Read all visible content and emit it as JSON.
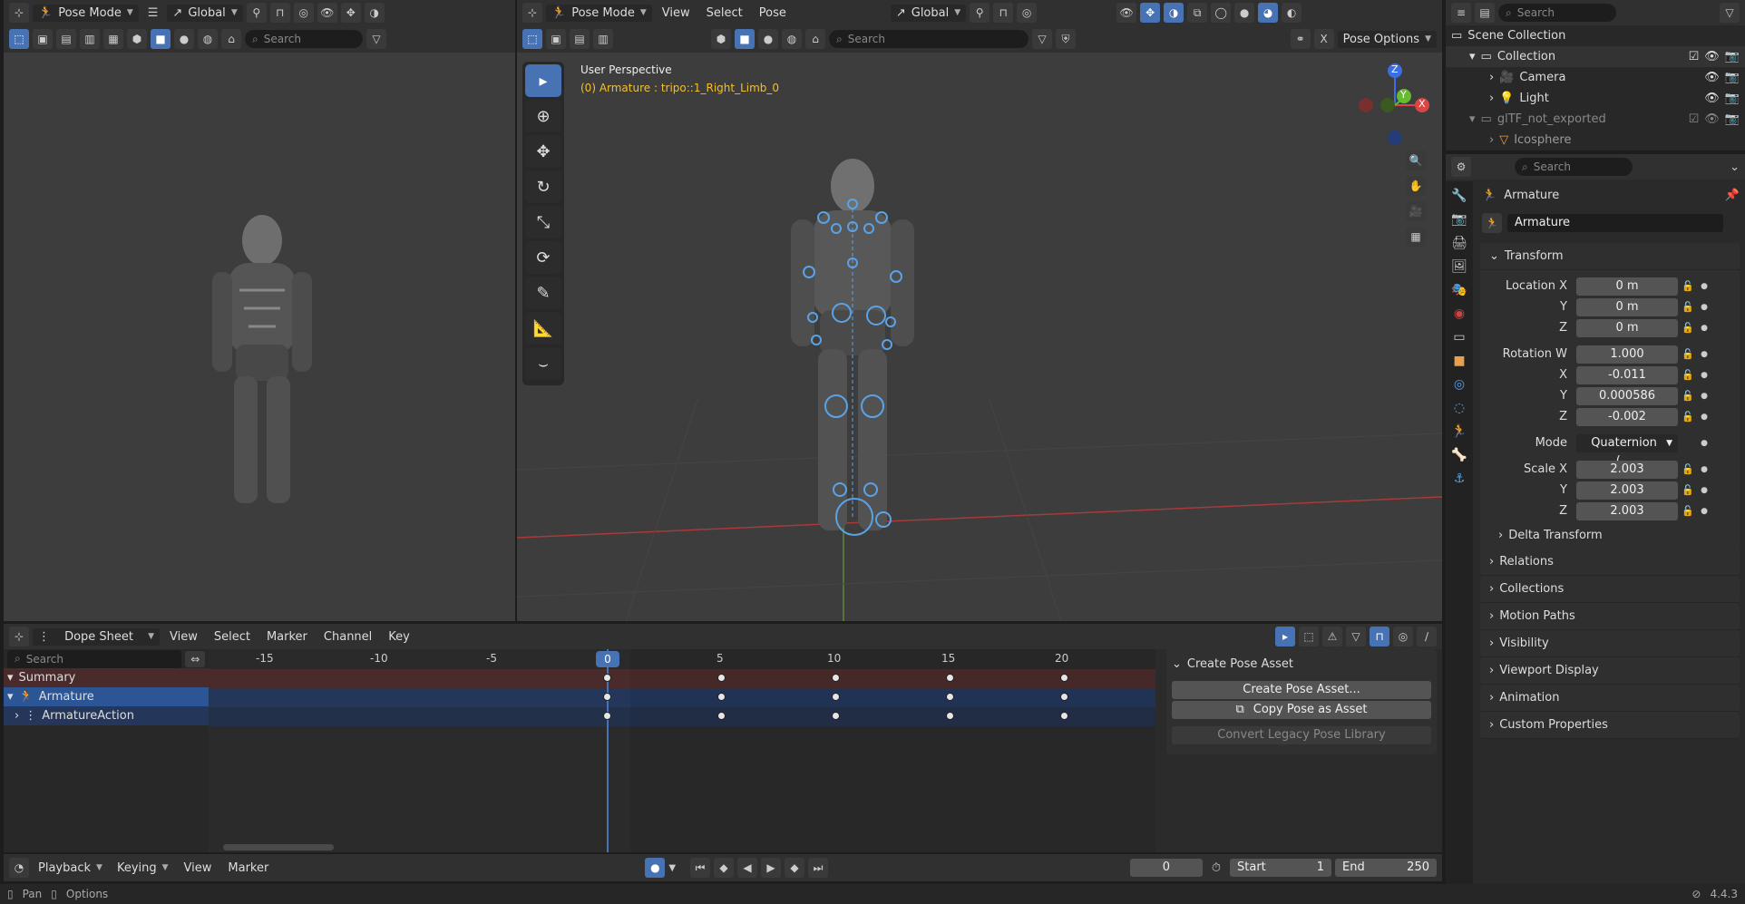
{
  "left_viewport": {
    "mode": "Pose Mode",
    "orientation": "Global",
    "search_placeholder": "Search"
  },
  "main_viewport": {
    "editor_menu": [
      "View",
      "Select",
      "Pose"
    ],
    "mode": "Pose Mode",
    "orientation": "Global",
    "search_placeholder": "Search",
    "perspective_label": "User Perspective",
    "active_object_label": "(0) Armature : tripo::1_Right_Limb_0",
    "pose_options": "Pose Options",
    "gizmo_axes": [
      "Z",
      "Y",
      "X"
    ]
  },
  "outliner": {
    "search_placeholder": "Search",
    "items": [
      {
        "label": "Scene Collection"
      },
      {
        "label": "Collection"
      },
      {
        "label": "Camera"
      },
      {
        "label": "Light"
      },
      {
        "label": "glTF_not_exported"
      },
      {
        "label": "Icosphere"
      }
    ]
  },
  "properties": {
    "search_placeholder": "Search",
    "object_name": "Armature",
    "data_name": "Armature",
    "transform_label": "Transform",
    "location": [
      {
        "label": "Location X",
        "value": "0 m"
      },
      {
        "label": "Y",
        "value": "0 m"
      },
      {
        "label": "Z",
        "value": "0 m"
      }
    ],
    "rotation": [
      {
        "label": "Rotation W",
        "value": "1.000"
      },
      {
        "label": "X",
        "value": "-0.011"
      },
      {
        "label": "Y",
        "value": "0.000586"
      },
      {
        "label": "Z",
        "value": "-0.002"
      }
    ],
    "mode_label": "Mode",
    "mode_value": "Quaternion (...",
    "scale": [
      {
        "label": "Scale X",
        "value": "2.003"
      },
      {
        "label": "Y",
        "value": "2.003"
      },
      {
        "label": "Z",
        "value": "2.003"
      }
    ],
    "delta_transform": "Delta Transform",
    "panels": [
      "Relations",
      "Collections",
      "Motion Paths",
      "Visibility",
      "Viewport Display",
      "Animation",
      "Custom Properties"
    ]
  },
  "dopesheet": {
    "editor": "Dope Sheet",
    "menu": [
      "View",
      "Select",
      "Marker",
      "Channel",
      "Key"
    ],
    "search_placeholder": "Search",
    "channels": [
      {
        "label": "Summary"
      },
      {
        "label": "Armature"
      },
      {
        "label": "ArmatureAction"
      }
    ],
    "ruler": [
      "-15",
      "-10",
      "-5",
      "0",
      "5",
      "10",
      "15",
      "20"
    ],
    "current_frame": "0",
    "keyframes": [
      0,
      5,
      10,
      15,
      20
    ]
  },
  "pose_asset_panel": {
    "title": "Create Pose Asset",
    "create_button": "Create Pose Asset...",
    "copy_button": "Copy Pose as Asset",
    "convert_button": "Convert Legacy Pose Library"
  },
  "timeline": {
    "menus": [
      "Playback",
      "Keying",
      "View",
      "Marker"
    ],
    "frame": "0",
    "start_label": "Start",
    "start_value": "1",
    "end_label": "End",
    "end_value": "250"
  },
  "statusbar": {
    "pan": "Pan",
    "options": "Options",
    "version": "4.4.3"
  },
  "colors": {
    "accent": "#4772b3",
    "keyframe": "#e6e6e6",
    "summary_row": "#4a2b2b",
    "armature_row": "#24375a"
  }
}
